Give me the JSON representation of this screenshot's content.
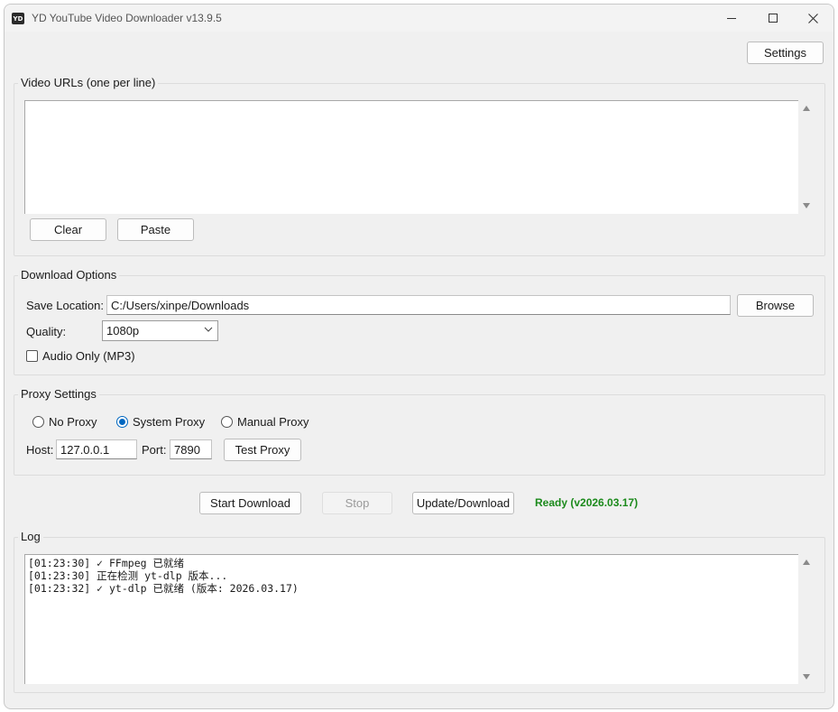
{
  "window": {
    "title": "YD YouTube Video Downloader v13.9.5",
    "icon_text": "YD"
  },
  "toolbar": {
    "settings_label": "Settings"
  },
  "urls": {
    "group_title": "Video URLs (one per line)",
    "value": "",
    "clear_label": "Clear",
    "paste_label": "Paste"
  },
  "download_options": {
    "group_title": "Download Options",
    "save_location_label": "Save Location:",
    "save_location_value": "C:/Users/xinpe/Downloads",
    "browse_label": "Browse",
    "quality_label": "Quality:",
    "quality_value": "1080p",
    "audio_only_label": "Audio Only (MP3)",
    "audio_only_checked": false
  },
  "proxy": {
    "group_title": "Proxy Settings",
    "options": [
      {
        "label": "No Proxy",
        "checked": false
      },
      {
        "label": "System Proxy",
        "checked": true
      },
      {
        "label": "Manual Proxy",
        "checked": false
      }
    ],
    "host_label": "Host:",
    "host_value": "127.0.0.1",
    "port_label": "Port:",
    "port_value": "7890",
    "test_label": "Test Proxy"
  },
  "actions": {
    "start_label": "Start Download",
    "stop_label": "Stop",
    "update_label": "Update/Download",
    "status_text": "Ready (v2026.03.17)",
    "status_color": "#1c8a1c"
  },
  "log": {
    "group_title": "Log",
    "lines": [
      "[01:23:30] ✓ FFmpeg 已就绪",
      "[01:23:30] 正在检测 yt-dlp 版本...",
      "[01:23:32] ✓ yt-dlp 已就绪 (版本: 2026.03.17)"
    ]
  }
}
